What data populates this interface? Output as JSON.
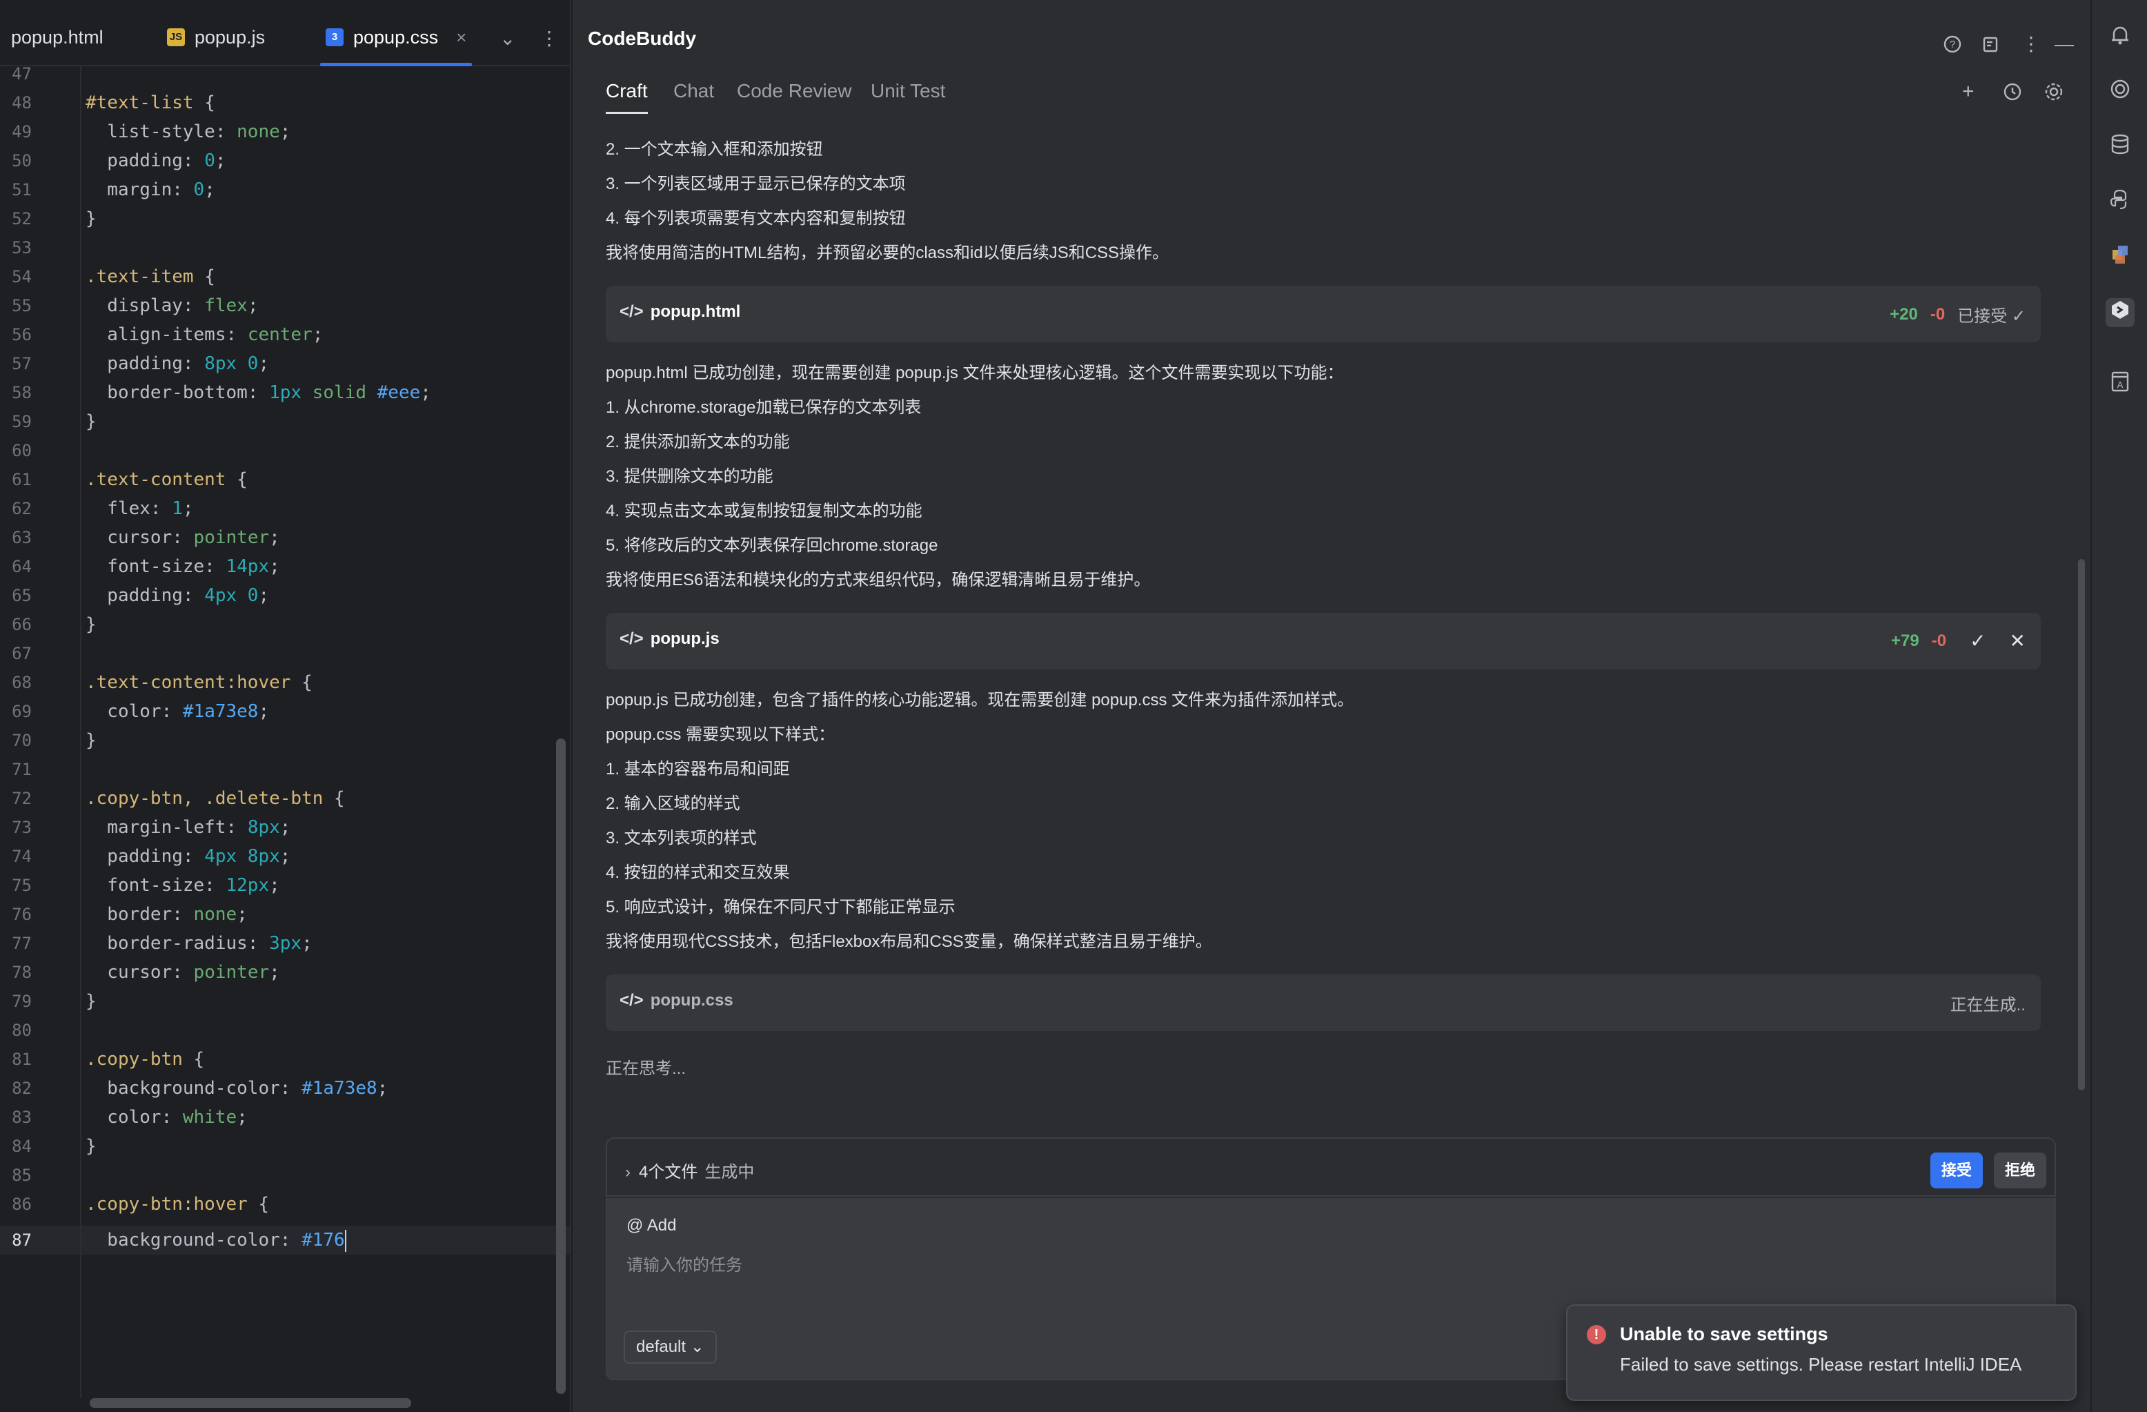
{
  "editor": {
    "tabs": [
      {
        "label": "popup.html",
        "icon": "html-file-icon"
      },
      {
        "label": "popup.js",
        "icon": "js-file-icon",
        "badge": "JS"
      },
      {
        "label": "popup.css",
        "icon": "css-file-icon",
        "active": true
      }
    ],
    "close_glyph": "×",
    "line_numbers": [
      "47",
      "48",
      "49",
      "50",
      "51",
      "52",
      "53",
      "54",
      "55",
      "56",
      "57",
      "58",
      "59",
      "60",
      "61",
      "62",
      "63",
      "64",
      "65",
      "66",
      "67",
      "68",
      "69",
      "70",
      "71",
      "72",
      "73",
      "74",
      "75",
      "76",
      "77",
      "78",
      "79",
      "80",
      "81",
      "82",
      "83",
      "84",
      "85",
      "86",
      "87"
    ],
    "code": {
      "l48": {
        "sel": "#text-list",
        "punc": " {"
      },
      "l49": {
        "prop": "  list-style: ",
        "val": "none",
        "end": ";"
      },
      "l50": {
        "prop": "  padding: ",
        "val": "0",
        "end": ";"
      },
      "l51": {
        "prop": "  margin: ",
        "val": "0",
        "end": ";"
      },
      "l52": "}",
      "l54": {
        "sel": ".text-item",
        "punc": " {"
      },
      "l55": {
        "prop": "  display: ",
        "val": "flex",
        "end": ";"
      },
      "l56": {
        "prop": "  align-items: ",
        "val": "center",
        "end": ";"
      },
      "l57": {
        "prop": "  padding: ",
        "val": "8px 0",
        "end": ";"
      },
      "l58": {
        "prop": "  border-bottom: ",
        "num": "1px ",
        "kw": "solid ",
        "hex": "#eee",
        "end": ";"
      },
      "l59": "}",
      "l61": {
        "sel": ".text-content",
        "punc": " {"
      },
      "l62": {
        "prop": "  flex: ",
        "val": "1",
        "end": ";"
      },
      "l63": {
        "prop": "  cursor: ",
        "val": "pointer",
        "end": ";"
      },
      "l64": {
        "prop": "  font-size: ",
        "val": "14px",
        "end": ";"
      },
      "l65": {
        "prop": "  padding: ",
        "val": "4px 0",
        "end": ";"
      },
      "l66": "}",
      "l68": {
        "sel": ".text-content:hover",
        "punc": " {"
      },
      "l69": {
        "prop": "  color: ",
        "val": "#1a73e8",
        "end": ";"
      },
      "l70": "}",
      "l72": {
        "sel": ".copy-btn, .delete-btn",
        "punc": " {"
      },
      "l73": {
        "prop": "  margin-left: ",
        "val": "8px",
        "end": ";"
      },
      "l74": {
        "prop": "  padding: ",
        "val": "4px 8px",
        "end": ";"
      },
      "l75": {
        "prop": "  font-size: ",
        "val": "12px",
        "end": ";"
      },
      "l76": {
        "prop": "  border: ",
        "val": "none",
        "end": ";"
      },
      "l77": {
        "prop": "  border-radius: ",
        "val": "3px",
        "end": ";"
      },
      "l78": {
        "prop": "  cursor: ",
        "val": "pointer",
        "end": ";"
      },
      "l79": "}",
      "l81": {
        "sel": ".copy-btn",
        "punc": " {"
      },
      "l82": {
        "prop": "  background-color: ",
        "val": "#1a73e8",
        "end": ";"
      },
      "l83": {
        "prop": "  color: ",
        "val": "white",
        "end": ";"
      },
      "l84": "}",
      "l86": {
        "sel": ".copy-btn:hover",
        "punc": " {"
      },
      "l87": {
        "prop": "  background-color: ",
        "val": "#176"
      }
    }
  },
  "panel": {
    "title": "CodeBuddy",
    "header_icons": [
      "help-icon",
      "notes-icon",
      "more-icon",
      "minimize-icon"
    ],
    "tabs": [
      "Craft",
      "Chat",
      "Code Review",
      "Unit Test"
    ],
    "active_tab": "Craft",
    "tab_icons": [
      "plus-icon",
      "history-icon",
      "settings-icon"
    ],
    "messages": {
      "m1": "2. 一个文本输入框和添加按钮",
      "m2": "3. 一个列表区域用于显示已保存的文本项",
      "m3": "4. 每个列表项需要有文本内容和复制按钮",
      "m4": "我将使用简洁的HTML结构，并预留必要的class和id以便后续JS和CSS操作。",
      "m5": "popup.html 已成功创建，现在需要创建 popup.js 文件来处理核心逻辑。这个文件需要实现以下功能：",
      "m6": "1. 从chrome.storage加载已保存的文本列表",
      "m7": "2. 提供添加新文本的功能",
      "m8": "3. 提供删除文本的功能",
      "m9": "4. 实现点击文本或复制按钮复制文本的功能",
      "m10": "5. 将修改后的文本列表保存回chrome.storage",
      "m11": "我将使用ES6语法和模块化的方式来组织代码，确保逻辑清晰且易于维护。",
      "m12": "popup.js 已成功创建，包含了插件的核心功能逻辑。现在需要创建 popup.css 文件来为插件添加样式。",
      "m13": "popup.css 需要实现以下样式：",
      "m14": "1. 基本的容器布局和间距",
      "m15": "2. 输入区域的样式",
      "m16": "3. 文本列表项的样式",
      "m17": "4. 按钮的样式和交互效果",
      "m18": "5. 响应式设计，确保在不同尺寸下都能正常显示",
      "m19": "我将使用现代CSS技术，包括Flexbox布局和CSS变量，确保样式整洁且易于维护。",
      "thinking": "正在思考..."
    },
    "file_cards": {
      "html": {
        "code_glyph": "</>",
        "name": "popup.html",
        "added": "+20",
        "removed": "-0",
        "status": "已接受"
      },
      "js": {
        "code_glyph": "</>",
        "name": "popup.js",
        "added": "+79",
        "removed": "-0"
      },
      "css": {
        "code_glyph": "</>",
        "name": "popup.css",
        "status": "正在生成.."
      }
    },
    "generation": {
      "label": "4个文件",
      "sub": "生成中",
      "accept": "接受",
      "reject": "拒绝"
    },
    "input": {
      "mention": "@ Add",
      "placeholder": "请输入你的任务",
      "value": "",
      "model": "default"
    }
  },
  "notification": {
    "title": "Unable to save settings",
    "body": "Failed to save settings. Please restart IntelliJ IDEA"
  },
  "toolstrip": {
    "icons": [
      "notifications-icon",
      "codebuddy-swirl-icon",
      "database-icon",
      "python-icon",
      "plugins-icon",
      "codebuddy-icon",
      "translate-icon"
    ]
  }
}
